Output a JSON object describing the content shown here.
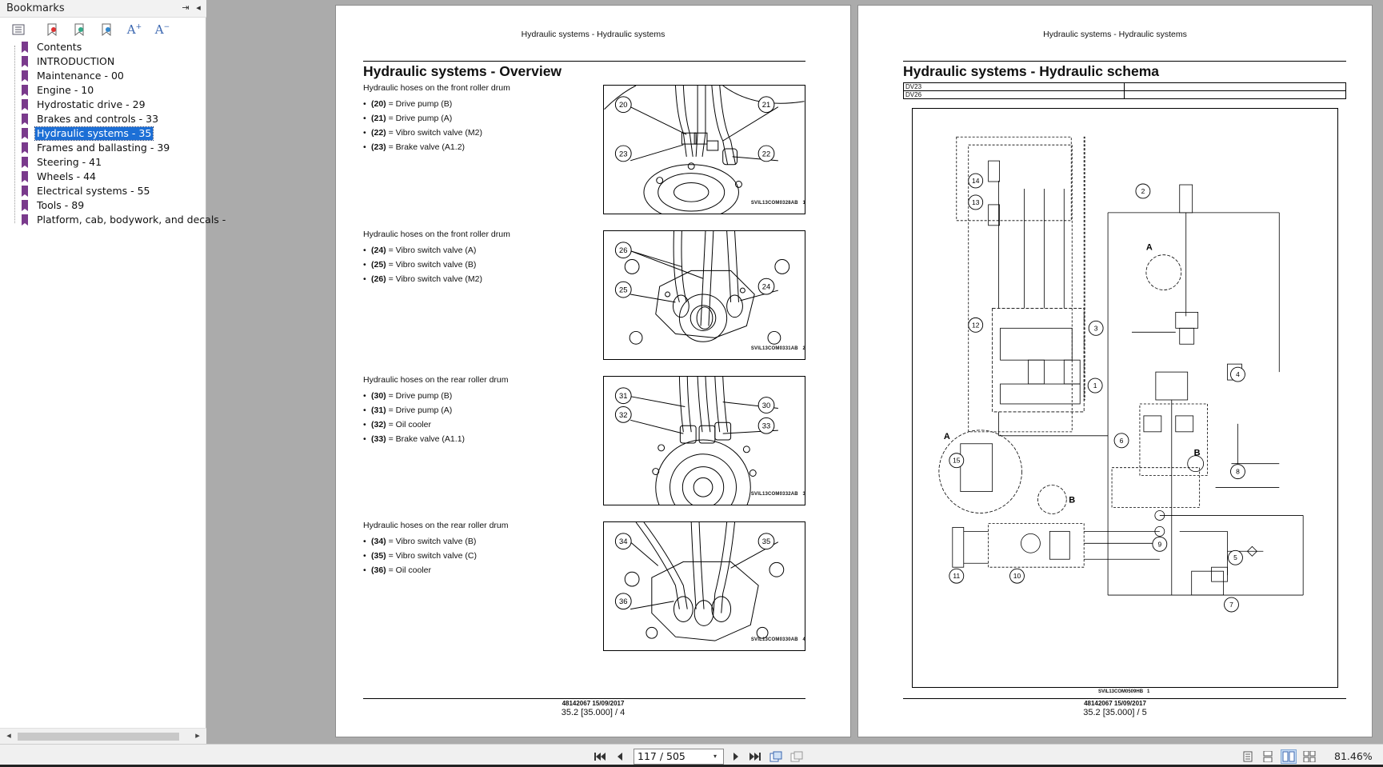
{
  "sidebar": {
    "title": "Bookmarks",
    "items": [
      {
        "label": "Contents"
      },
      {
        "label": "INTRODUCTION"
      },
      {
        "label": "Maintenance - 00"
      },
      {
        "label": "Engine - 10"
      },
      {
        "label": "Hydrostatic drive - 29"
      },
      {
        "label": "Brakes and controls - 33"
      },
      {
        "label": "Hydraulic systems - 35",
        "selected": true
      },
      {
        "label": "Frames and ballasting - 39"
      },
      {
        "label": "Steering - 41"
      },
      {
        "label": "Wheels - 44"
      },
      {
        "label": "Electrical systems - 55"
      },
      {
        "label": "Tools - 89"
      },
      {
        "label": "Platform, cab, bodywork, and decals -"
      }
    ],
    "toolbar_icons": [
      "bookmark-options-icon",
      "expand-bookmark-icon",
      "add-bookmark-icon",
      "delete-bookmark-icon",
      "increase-text-size-icon",
      "decrease-text-size-icon"
    ],
    "colors": {
      "selected_bg": "#1c6fd6",
      "bookmark_icon": "#7a3a8c"
    }
  },
  "left_page": {
    "header": "Hydraulic systems - Hydraulic systems",
    "title": "Hydraulic systems - Overview",
    "sections": [
      {
        "intro": "Hydraulic hoses on the front roller drum",
        "items": [
          {
            "num": "(20)",
            "text": "= Drive pump (B)"
          },
          {
            "num": "(21)",
            "text": "= Drive pump (A)"
          },
          {
            "num": "(22)",
            "text": "= Vibro switch valve (M2)"
          },
          {
            "num": "(23)",
            "text": "= Brake valve (A1.2)"
          }
        ],
        "figure": {
          "callouts": [
            "20",
            "21",
            "23",
            "22"
          ],
          "code": "SVIL13COM0328AB",
          "num": "1"
        }
      },
      {
        "intro": "Hydraulic hoses on the front roller drum",
        "items": [
          {
            "num": "(24)",
            "text": "= Vibro switch valve (A)"
          },
          {
            "num": "(25)",
            "text": "= Vibro switch valve (B)"
          },
          {
            "num": "(26)",
            "text": "= Vibro switch valve (M2)"
          }
        ],
        "figure": {
          "callouts": [
            "26",
            "25",
            "24"
          ],
          "code": "SVIL13COM0331AB",
          "num": "2"
        }
      },
      {
        "intro": "Hydraulic hoses on the rear roller drum",
        "items": [
          {
            "num": "(30)",
            "text": "= Drive pump (B)"
          },
          {
            "num": "(31)",
            "text": "= Drive pump (A)"
          },
          {
            "num": "(32)",
            "text": "= Oil cooler"
          },
          {
            "num": "(33)",
            "text": "= Brake valve (A1.1)"
          }
        ],
        "figure": {
          "callouts": [
            "31",
            "32",
            "30",
            "33"
          ],
          "code": "SVIL13COM0332AB",
          "num": "3"
        }
      },
      {
        "intro": "Hydraulic hoses on the rear roller drum",
        "items": [
          {
            "num": "(34)",
            "text": "= Vibro switch valve (B)"
          },
          {
            "num": "(35)",
            "text": "= Vibro switch valve (C)"
          },
          {
            "num": "(36)",
            "text": "= Oil cooler"
          }
        ],
        "figure": {
          "callouts": [
            "34",
            "35",
            "36"
          ],
          "code": "SVIL13COM0330AB",
          "num": "4"
        }
      }
    ],
    "footer_doc": "48142067 15/09/2017",
    "footer_page": "35.2 [35.000] / 4"
  },
  "right_page": {
    "header": "Hydraulic systems - Hydraulic systems",
    "title": "Hydraulic systems - Hydraulic schema",
    "table_rows": [
      "DV23",
      "DV26"
    ],
    "schema_callouts": [
      "1",
      "2",
      "3",
      "4",
      "5",
      "6",
      "7",
      "8",
      "9",
      "10",
      "11",
      "12",
      "13",
      "14",
      "15"
    ],
    "schema_letters": [
      "A",
      "A",
      "B",
      "B"
    ],
    "schema_code": "SVIL13COM0509HB",
    "schema_num": "1",
    "footer_doc": "48142067 15/09/2017",
    "footer_page": "35.2 [35.000] / 5"
  },
  "statusbar": {
    "page_field": "117 / 505",
    "zoom": "81.46%"
  }
}
